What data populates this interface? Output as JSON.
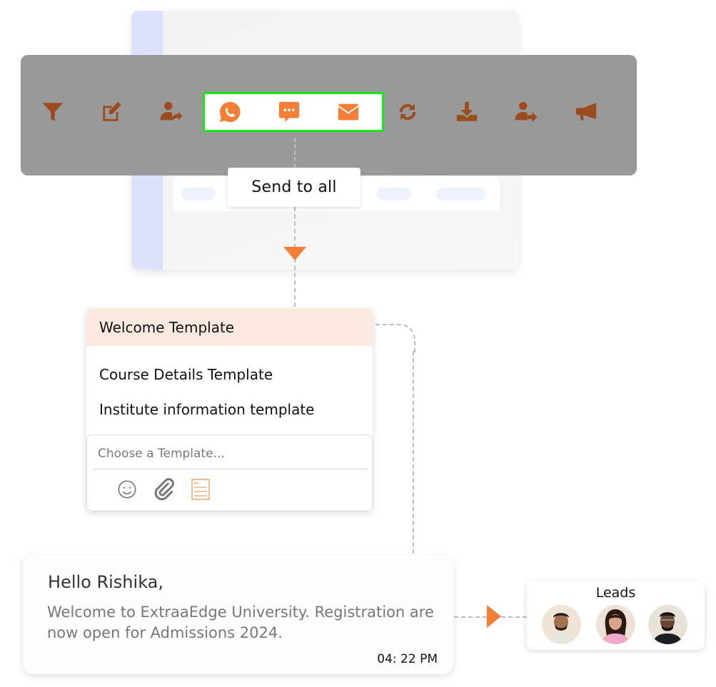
{
  "toolbar": {
    "icons": [
      {
        "name": "filter-icon",
        "color": "#9a4c1e"
      },
      {
        "name": "edit-icon",
        "color": "#9a4c1e"
      },
      {
        "name": "reassign-user-icon",
        "color": "#9a4c1e"
      },
      {
        "name": "whatsapp-icon",
        "color": "#f27f35"
      },
      {
        "name": "sms-icon",
        "color": "#f27f35"
      },
      {
        "name": "email-icon",
        "color": "#f27f35"
      },
      {
        "name": "sync-icon",
        "color": "#9a4c1e"
      },
      {
        "name": "download-icon",
        "color": "#9a4c1e"
      },
      {
        "name": "transfer-user-icon",
        "color": "#9a4c1e"
      },
      {
        "name": "megaphone-icon",
        "color": "#9a4c1e"
      }
    ],
    "highlight_color": "#16e81a"
  },
  "tooltip": {
    "label": "Send to all"
  },
  "templates": {
    "items": [
      {
        "label": "Welcome Template",
        "active": true
      },
      {
        "label": "Course Details Template",
        "active": false
      },
      {
        "label": "Institute information template",
        "active": false
      }
    ],
    "composer": {
      "placeholder": "Choose a Template...",
      "value": "",
      "icons": [
        "emoji-icon",
        "attachment-icon",
        "template-icon"
      ]
    }
  },
  "message": {
    "greeting": "Hello Rishika,",
    "body": "Welcome to ExtraaEdge University. Registration are now open for Admissions 2024.",
    "time": "04: 22 PM"
  },
  "leads": {
    "title": "Leads",
    "avatars": [
      "lead-avatar-1",
      "lead-avatar-2",
      "lead-avatar-3"
    ]
  },
  "colors": {
    "accent": "#f27f35",
    "icon_dark": "#9a4c1e",
    "toolbar_bg": "#999999",
    "active_item_bg": "#fce9df"
  }
}
